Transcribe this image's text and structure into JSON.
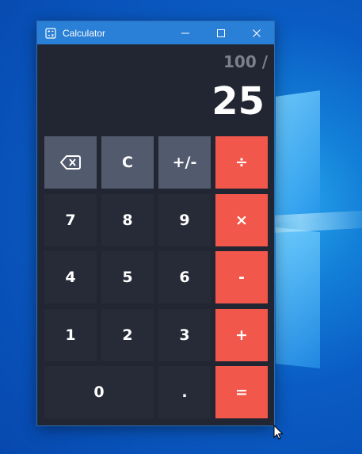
{
  "window": {
    "title": "Calculator"
  },
  "display": {
    "expression": "100 /",
    "result": "25"
  },
  "keys": {
    "backspace": "backspace",
    "clear": "C",
    "negate": "+/-",
    "divide": "÷",
    "seven": "7",
    "eight": "8",
    "nine": "9",
    "multiply": "×",
    "four": "4",
    "five": "5",
    "six": "6",
    "subtract": "-",
    "one": "1",
    "two": "2",
    "three": "3",
    "add": "+",
    "zero": "0",
    "decimal": ".",
    "equals": "="
  },
  "colors": {
    "titlebar": "#2a7fd6",
    "window_bg": "#222633",
    "digit_key": "#262b37",
    "function_key": "#525a6d",
    "operator_key": "#f2574b",
    "expression_text": "#7c808c"
  },
  "icons": [
    "calculator-app-icon",
    "minimize-icon",
    "maximize-icon",
    "close-icon",
    "backspace-icon",
    "mouse-cursor-icon"
  ]
}
